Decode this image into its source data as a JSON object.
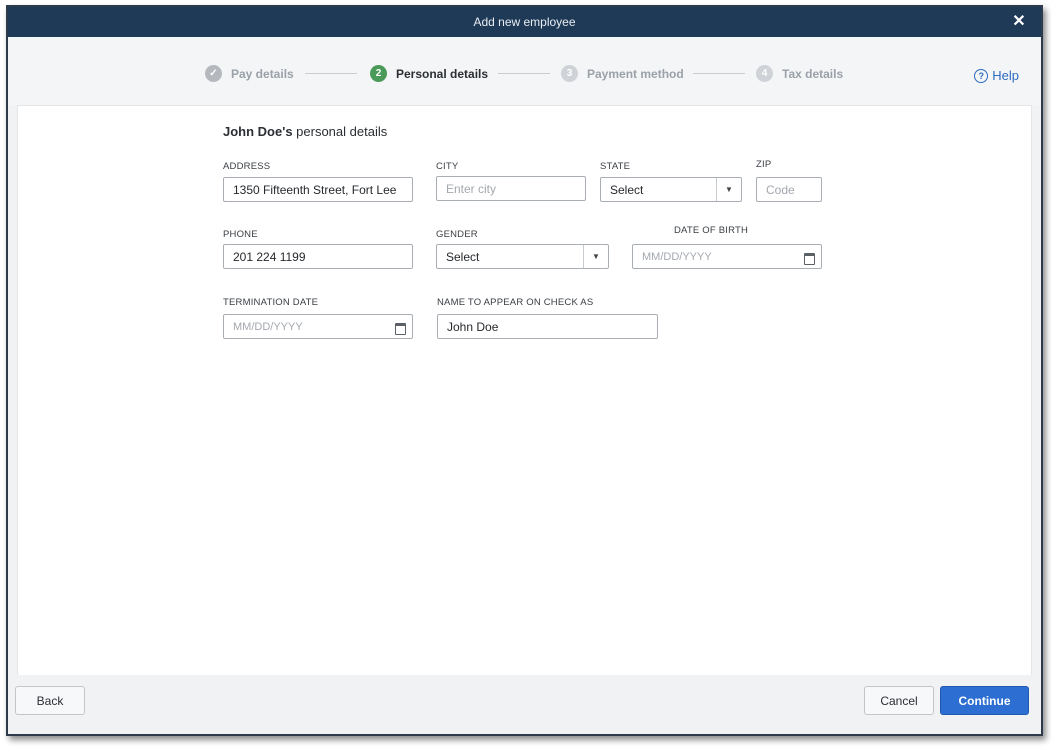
{
  "window": {
    "title": "Add new employee"
  },
  "stepper": {
    "steps": [
      {
        "number": "✓",
        "label": "Pay details"
      },
      {
        "number": "2",
        "label": "Personal details"
      },
      {
        "number": "3",
        "label": "Payment method"
      },
      {
        "number": "4",
        "label": "Tax details"
      }
    ],
    "help_icon": "?",
    "help_label": "Help"
  },
  "form": {
    "heading_name": "John Doe's",
    "heading_suffix": " personal details",
    "address": {
      "label": "ADDRESS",
      "value": "1350 Fifteenth Street, Fort Lee"
    },
    "city": {
      "label": "CITY",
      "placeholder": "Enter city"
    },
    "state": {
      "label": "STATE",
      "value": "Select"
    },
    "zip": {
      "label": "ZIP",
      "placeholder": "Code"
    },
    "phone": {
      "label": "PHONE",
      "value": "201 224 1199"
    },
    "gender": {
      "label": "GENDER",
      "value": "Select"
    },
    "dob": {
      "label": "DATE OF BIRTH",
      "placeholder": "MM/DD/YYYY"
    },
    "termination": {
      "label": "TERMINATION DATE",
      "placeholder": "MM/DD/YYYY"
    },
    "check_name": {
      "label": "NAME TO APPEAR ON CHECK AS",
      "value": "John Doe"
    }
  },
  "footer": {
    "back_label": "Back",
    "cancel_label": "Cancel",
    "continue_label": "Continue"
  },
  "icons": {
    "close": "close-icon",
    "help": "help-circle-icon",
    "dropdown": "chevron-down-icon",
    "calendar": "calendar-icon",
    "step_done": "check-icon"
  },
  "colors": {
    "titlebar": "#1f3a57",
    "active_step": "#4a9b59",
    "primary_button": "#2c6ed1",
    "link": "#2c6bbf"
  }
}
